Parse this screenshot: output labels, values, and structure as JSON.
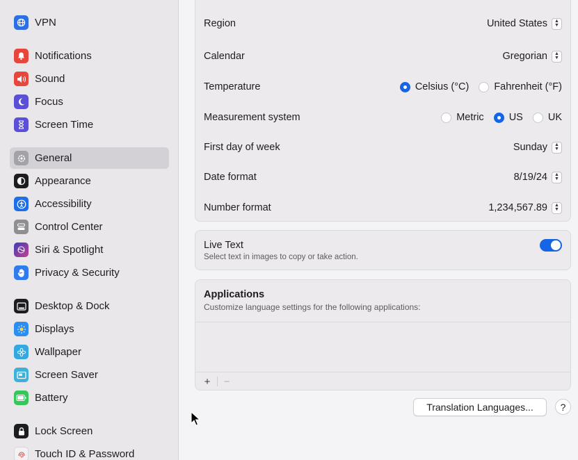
{
  "sidebar": {
    "items": [
      {
        "label": "VPN",
        "icon": "globe-icon",
        "color": "#2e6fe3",
        "selected": false
      },
      {
        "label": "Notifications",
        "icon": "bell-icon",
        "color": "#e8453c",
        "selected": false
      },
      {
        "label": "Sound",
        "icon": "speaker-icon",
        "color": "#e8453c",
        "selected": false
      },
      {
        "label": "Focus",
        "icon": "moon-icon",
        "color": "#5a4fd6",
        "selected": false
      },
      {
        "label": "Screen Time",
        "icon": "hourglass-icon",
        "color": "#5a4fd6",
        "selected": false
      },
      {
        "label": "General",
        "icon": "gear-icon",
        "color": "#8e8e93",
        "selected": true
      },
      {
        "label": "Appearance",
        "icon": "appearance-icon",
        "color": "#1d1d1f",
        "selected": false
      },
      {
        "label": "Accessibility",
        "icon": "accessibility-icon",
        "color": "#1e6ee8",
        "selected": false
      },
      {
        "label": "Control Center",
        "icon": "control-center-icon",
        "color": "#8e8e93",
        "selected": false
      },
      {
        "label": "Siri & Spotlight",
        "icon": "siri-icon",
        "color": "#7b3fc4",
        "selected": false
      },
      {
        "label": "Privacy & Security",
        "icon": "hand-icon",
        "color": "#2f7cf0",
        "selected": false
      },
      {
        "label": "Desktop & Dock",
        "icon": "dock-icon",
        "color": "#1d1d1f",
        "selected": false
      },
      {
        "label": "Displays",
        "icon": "sun-icon",
        "color": "#2b8ef0",
        "selected": false
      },
      {
        "label": "Wallpaper",
        "icon": "flower-icon",
        "color": "#34a8e0",
        "selected": false
      },
      {
        "label": "Screen Saver",
        "icon": "screen-saver-icon",
        "color": "#3fb1d8",
        "selected": false
      },
      {
        "label": "Battery",
        "icon": "battery-icon",
        "color": "#34c759",
        "selected": false
      },
      {
        "label": "Lock Screen",
        "icon": "lock-icon",
        "color": "#1d1d1f",
        "selected": false
      },
      {
        "label": "Touch ID & Password",
        "icon": "fingerprint-icon",
        "color": "#e8453c",
        "selected": false
      }
    ]
  },
  "format_settings": {
    "region": {
      "label": "Region",
      "value": "United States"
    },
    "calendar": {
      "label": "Calendar",
      "value": "Gregorian"
    },
    "temperature": {
      "label": "Temperature",
      "options": [
        "Celsius (°C)",
        "Fahrenheit (°F)"
      ],
      "selected": "Celsius (°C)"
    },
    "measurement": {
      "label": "Measurement system",
      "options": [
        "Metric",
        "US",
        "UK"
      ],
      "selected": "US"
    },
    "first_day": {
      "label": "First day of week",
      "value": "Sunday"
    },
    "date_format": {
      "label": "Date format",
      "value": "8/19/24"
    },
    "number_format": {
      "label": "Number format",
      "value": "1,234,567.89"
    }
  },
  "live_text": {
    "title": "Live Text",
    "subtitle": "Select text in images to copy or take action.",
    "enabled": true
  },
  "applications": {
    "title": "Applications",
    "subtitle": "Customize language settings for the following applications:",
    "add_symbol": "+",
    "remove_symbol": "−"
  },
  "buttons": {
    "translation": "Translation Languages...",
    "help": "?"
  },
  "colors": {
    "accent": "#1565e6"
  }
}
